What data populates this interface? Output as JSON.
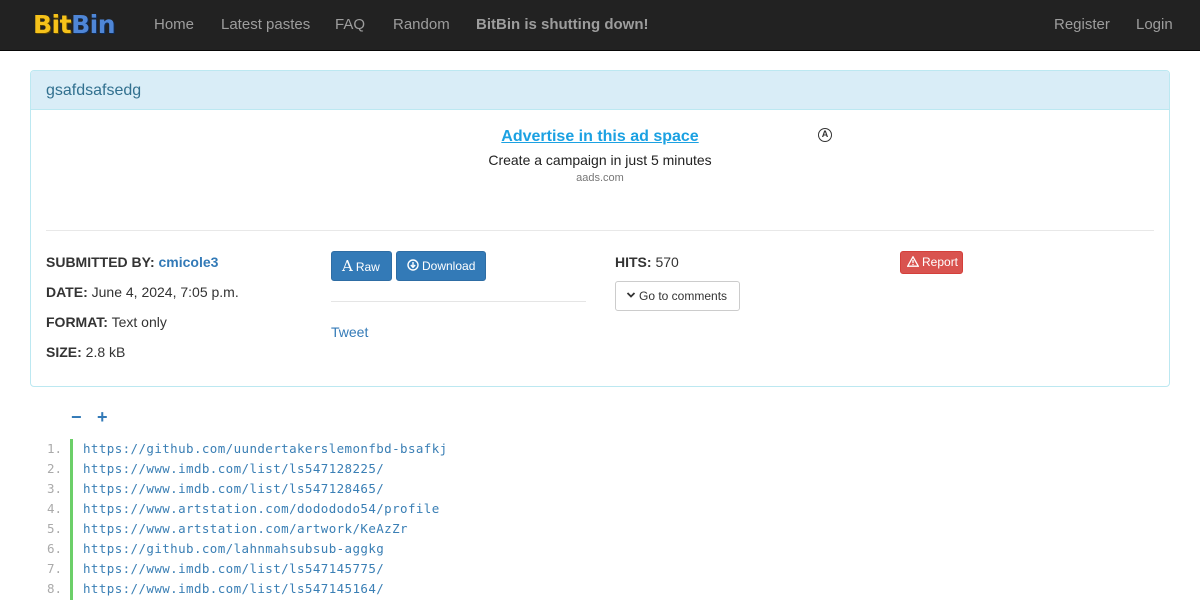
{
  "brand": {
    "part1": "Bit",
    "part2": "Bin"
  },
  "nav": {
    "home": "Home",
    "latest": "Latest pastes",
    "faq": "FAQ",
    "random": "Random",
    "notice": "BitBin is shutting down!",
    "register": "Register",
    "login": "Login"
  },
  "paste": {
    "title": "gsafdsafsedg",
    "ad": {
      "link": "Advertise in this ad space",
      "subtitle": "Create a campaign in just 5 minutes",
      "domain": "aads.com"
    },
    "meta": {
      "submitted_label": "SUBMITTED BY:",
      "submitted_value": "cmicole3",
      "date_label": "DATE:",
      "date_value": "June 4, 2024, 7:05 p.m.",
      "format_label": "FORMAT:",
      "format_value": "Text only",
      "size_label": "SIZE:",
      "size_value": "2.8 kB",
      "hits_label": "HITS:",
      "hits_value": "570"
    },
    "buttons": {
      "raw": "Raw",
      "download": "Download",
      "report": "Report",
      "comments": "Go to comments",
      "tweet": "Tweet"
    }
  },
  "fold": {
    "collapse": "−",
    "expand": "+"
  },
  "code_lines": [
    {
      "num": "1.",
      "text": "https://github.com/uundertakerslemonfbd-bsafkj"
    },
    {
      "num": "2.",
      "text": "https://www.imdb.com/list/ls547128225/"
    },
    {
      "num": "3.",
      "text": "https://www.imdb.com/list/ls547128465/"
    },
    {
      "num": "4.",
      "text": "https://www.artstation.com/dodododo54/profile"
    },
    {
      "num": "5.",
      "text": "https://www.artstation.com/artwork/KeAzZr"
    },
    {
      "num": "6.",
      "text": "https://github.com/lahnmahsubsub-aggkg"
    },
    {
      "num": "7.",
      "text": "https://www.imdb.com/list/ls547145775/"
    },
    {
      "num": "8.",
      "text": "https://www.imdb.com/list/ls547145164/"
    }
  ],
  "colors": {
    "navbar": "#222222",
    "link": "#337ab7",
    "panel_heading": "#d9edf7",
    "danger": "#d9534f",
    "code_bar": "#6ccf68"
  }
}
